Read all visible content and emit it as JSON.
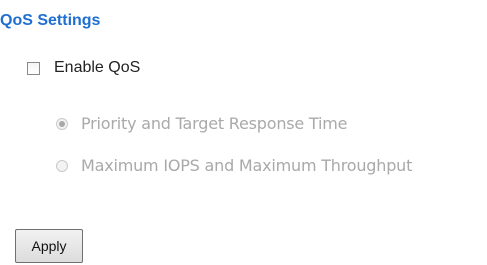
{
  "qos": {
    "title": "QoS Settings",
    "enable_label": "Enable QoS",
    "enable_checked": false,
    "options_disabled": true,
    "options": [
      {
        "label": "Priority and Target Response Time",
        "selected": true
      },
      {
        "label": "Maximum IOPS and Maximum Throughput",
        "selected": false
      }
    ],
    "apply_label": "Apply"
  },
  "colors": {
    "title": "#1f6fd1",
    "disabled_text": "#a9a9a9"
  }
}
